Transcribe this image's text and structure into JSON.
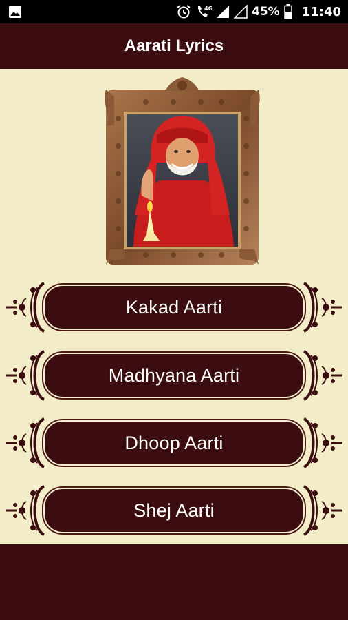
{
  "status_bar": {
    "battery_percent": "45%",
    "time": "11:40",
    "network_label": "4G",
    "icons": [
      "image-icon",
      "alarm-icon",
      "call-volte-icon",
      "signal-icon",
      "signal-empty-icon",
      "battery-icon"
    ]
  },
  "header": {
    "title": "Aarati Lyrics"
  },
  "image": {
    "name": "sai-baba-portrait-frame"
  },
  "aartis": [
    {
      "label": "Kakad Aarti"
    },
    {
      "label": "Madhyana Aarti"
    },
    {
      "label": "Dhoop Aarti"
    },
    {
      "label": "Shej Aarti"
    }
  ],
  "colors": {
    "primary": "#3c0d10",
    "background": "#f2ecc9",
    "ornament": "#3c0d10",
    "text": "#ffffff"
  }
}
